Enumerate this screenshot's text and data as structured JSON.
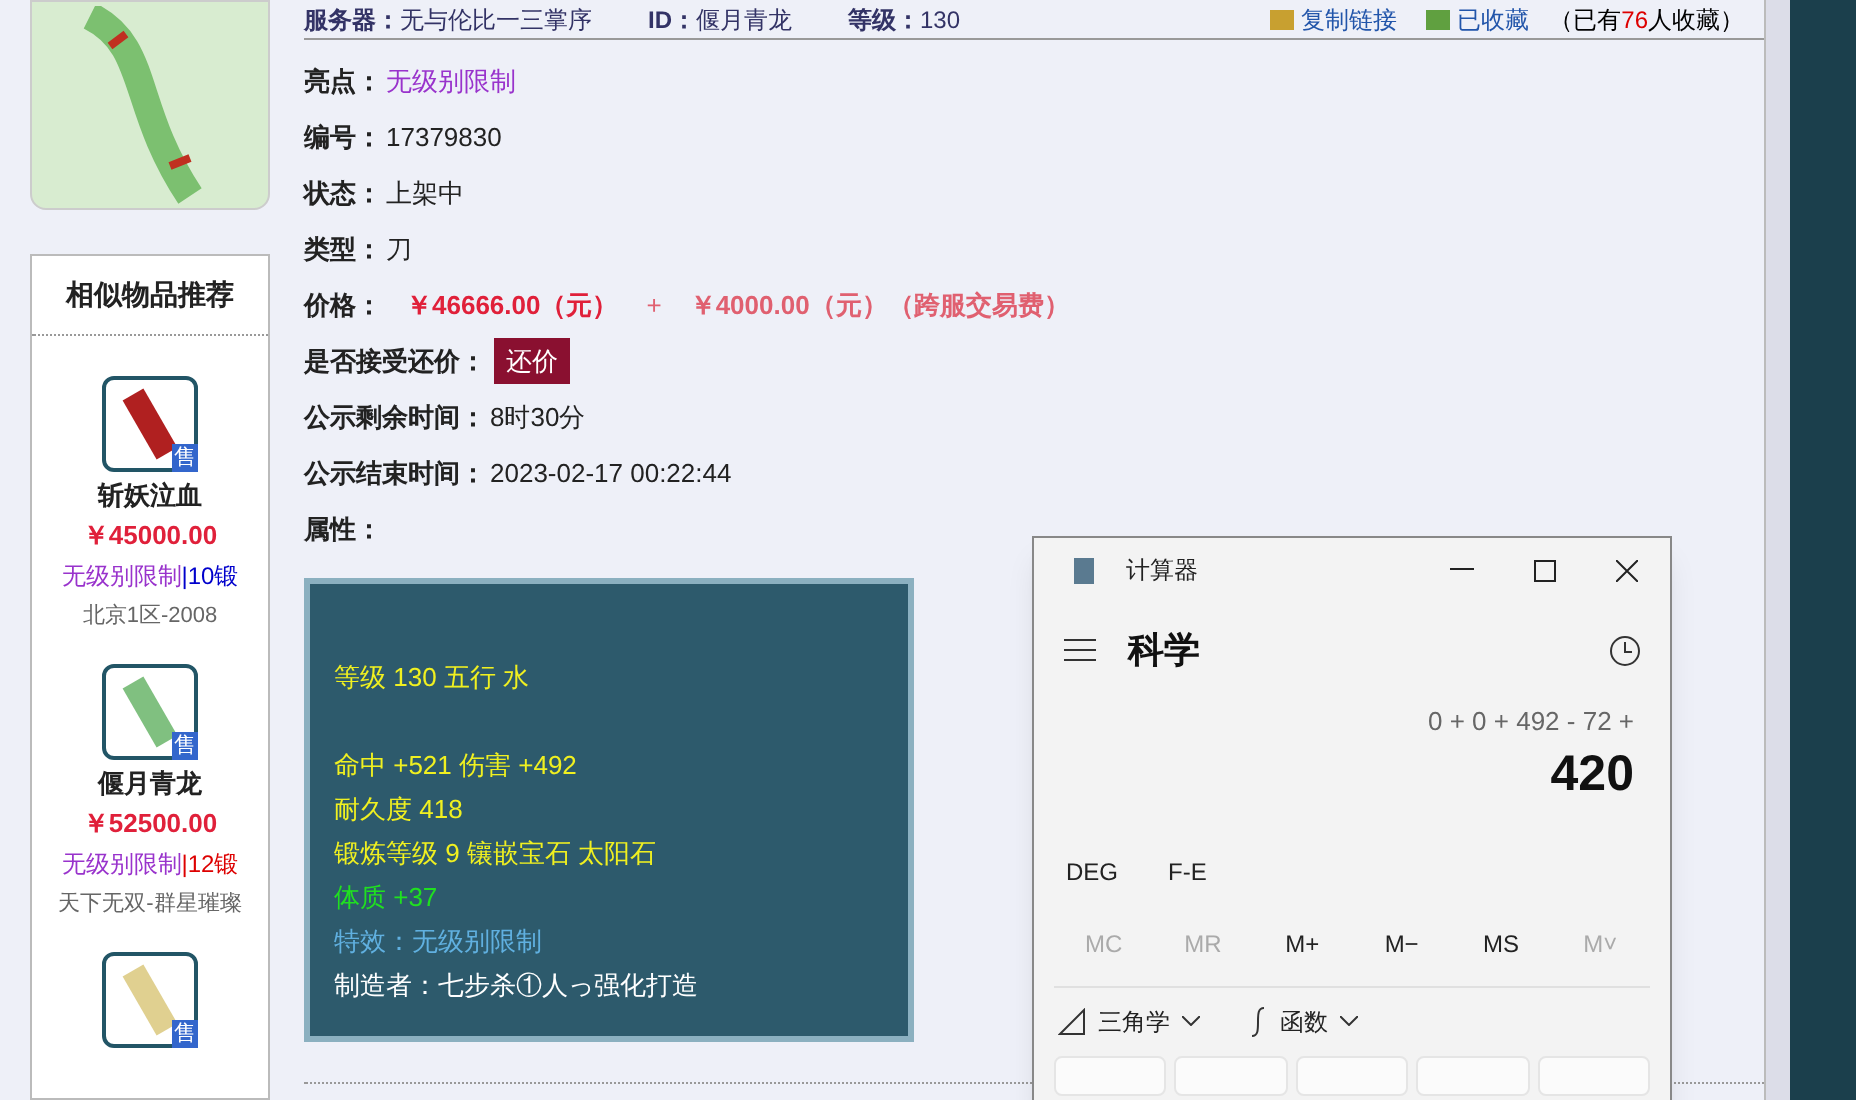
{
  "header": {
    "server_label": "服务器：",
    "server": "无与伦比一三掌序",
    "id_label": "ID：",
    "id": "偃月青龙",
    "level_label": "等级：",
    "level": "130",
    "copy_link": "复制链接",
    "favorited": "已收藏",
    "fav_count_prefix": "（已有",
    "fav_count": "76",
    "fav_count_suffix": "人收藏）"
  },
  "details": [
    {
      "kind": "highlight",
      "label": "亮点：",
      "value": "无级别限制"
    },
    {
      "kind": "plain",
      "label": "编号：",
      "value": "17379830"
    },
    {
      "kind": "plain",
      "label": "状态：",
      "value": "上架中"
    },
    {
      "kind": "plain",
      "label": "类型：",
      "value": "刀"
    },
    {
      "kind": "price",
      "label": "价格：",
      "value": "￥46666.00（元）",
      "plus": "+",
      "fee": "￥4000.00（元）（跨服交易费）"
    },
    {
      "kind": "button",
      "label": "是否接受还价：",
      "value": "还价"
    },
    {
      "kind": "plain",
      "label": "公示剩余时间：",
      "value": "8时30分"
    },
    {
      "kind": "plain",
      "label": "公示结束时间：",
      "value": "2023-02-17 00:22:44"
    },
    {
      "kind": "plain",
      "label": "属性："
    }
  ],
  "attributes": [
    {
      "kind": "blank"
    },
    {
      "kind": "yellow",
      "text": "等级 130 五行 水"
    },
    {
      "kind": "blank"
    },
    {
      "kind": "yellow",
      "text": "命中 +521 伤害 +492"
    },
    {
      "kind": "yellow",
      "text": "耐久度 418"
    },
    {
      "kind": "yellow",
      "text": "锻炼等级 9 镶嵌宝石 太阳石"
    },
    {
      "kind": "green",
      "text": "体质 +37"
    },
    {
      "kind": "blue",
      "text": "特效：无级别限制"
    },
    {
      "kind": "white",
      "text": "制造者：七步杀①人っ强化打造"
    }
  ],
  "recommend": {
    "title": "相似物品推荐",
    "items": [
      {
        "badge": "售",
        "name": "斩妖泣血",
        "price": "￥45000.00",
        "tag": "无级别限制",
        "forge": "|10锻",
        "color": "#0000cc",
        "server": "北京1区-2008"
      },
      {
        "badge": "售",
        "name": "偃月青龙",
        "price": "￥52500.00",
        "tag": "无级别限制",
        "forge": "|12锻",
        "color": "#dd0000",
        "server": "天下无双-群星璀璨"
      },
      {
        "badge": "售"
      }
    ]
  },
  "calculator": {
    "title": "计算器",
    "mode": "科学",
    "expression": "0 + 0 + 492 - 72 +",
    "result": "420",
    "toggles": [
      "DEG",
      "F-E"
    ],
    "memory": [
      {
        "label": "MC",
        "disabled": true
      },
      {
        "label": "MR",
        "disabled": true
      },
      {
        "label": "M+",
        "disabled": false
      },
      {
        "label": "M−",
        "disabled": false
      },
      {
        "label": "MS",
        "disabled": false
      },
      {
        "label": "M˅",
        "disabled": true
      }
    ],
    "menus": [
      {
        "kind": "trig",
        "label": "三角学"
      },
      {
        "kind": "func",
        "label": "函数"
      }
    ]
  }
}
